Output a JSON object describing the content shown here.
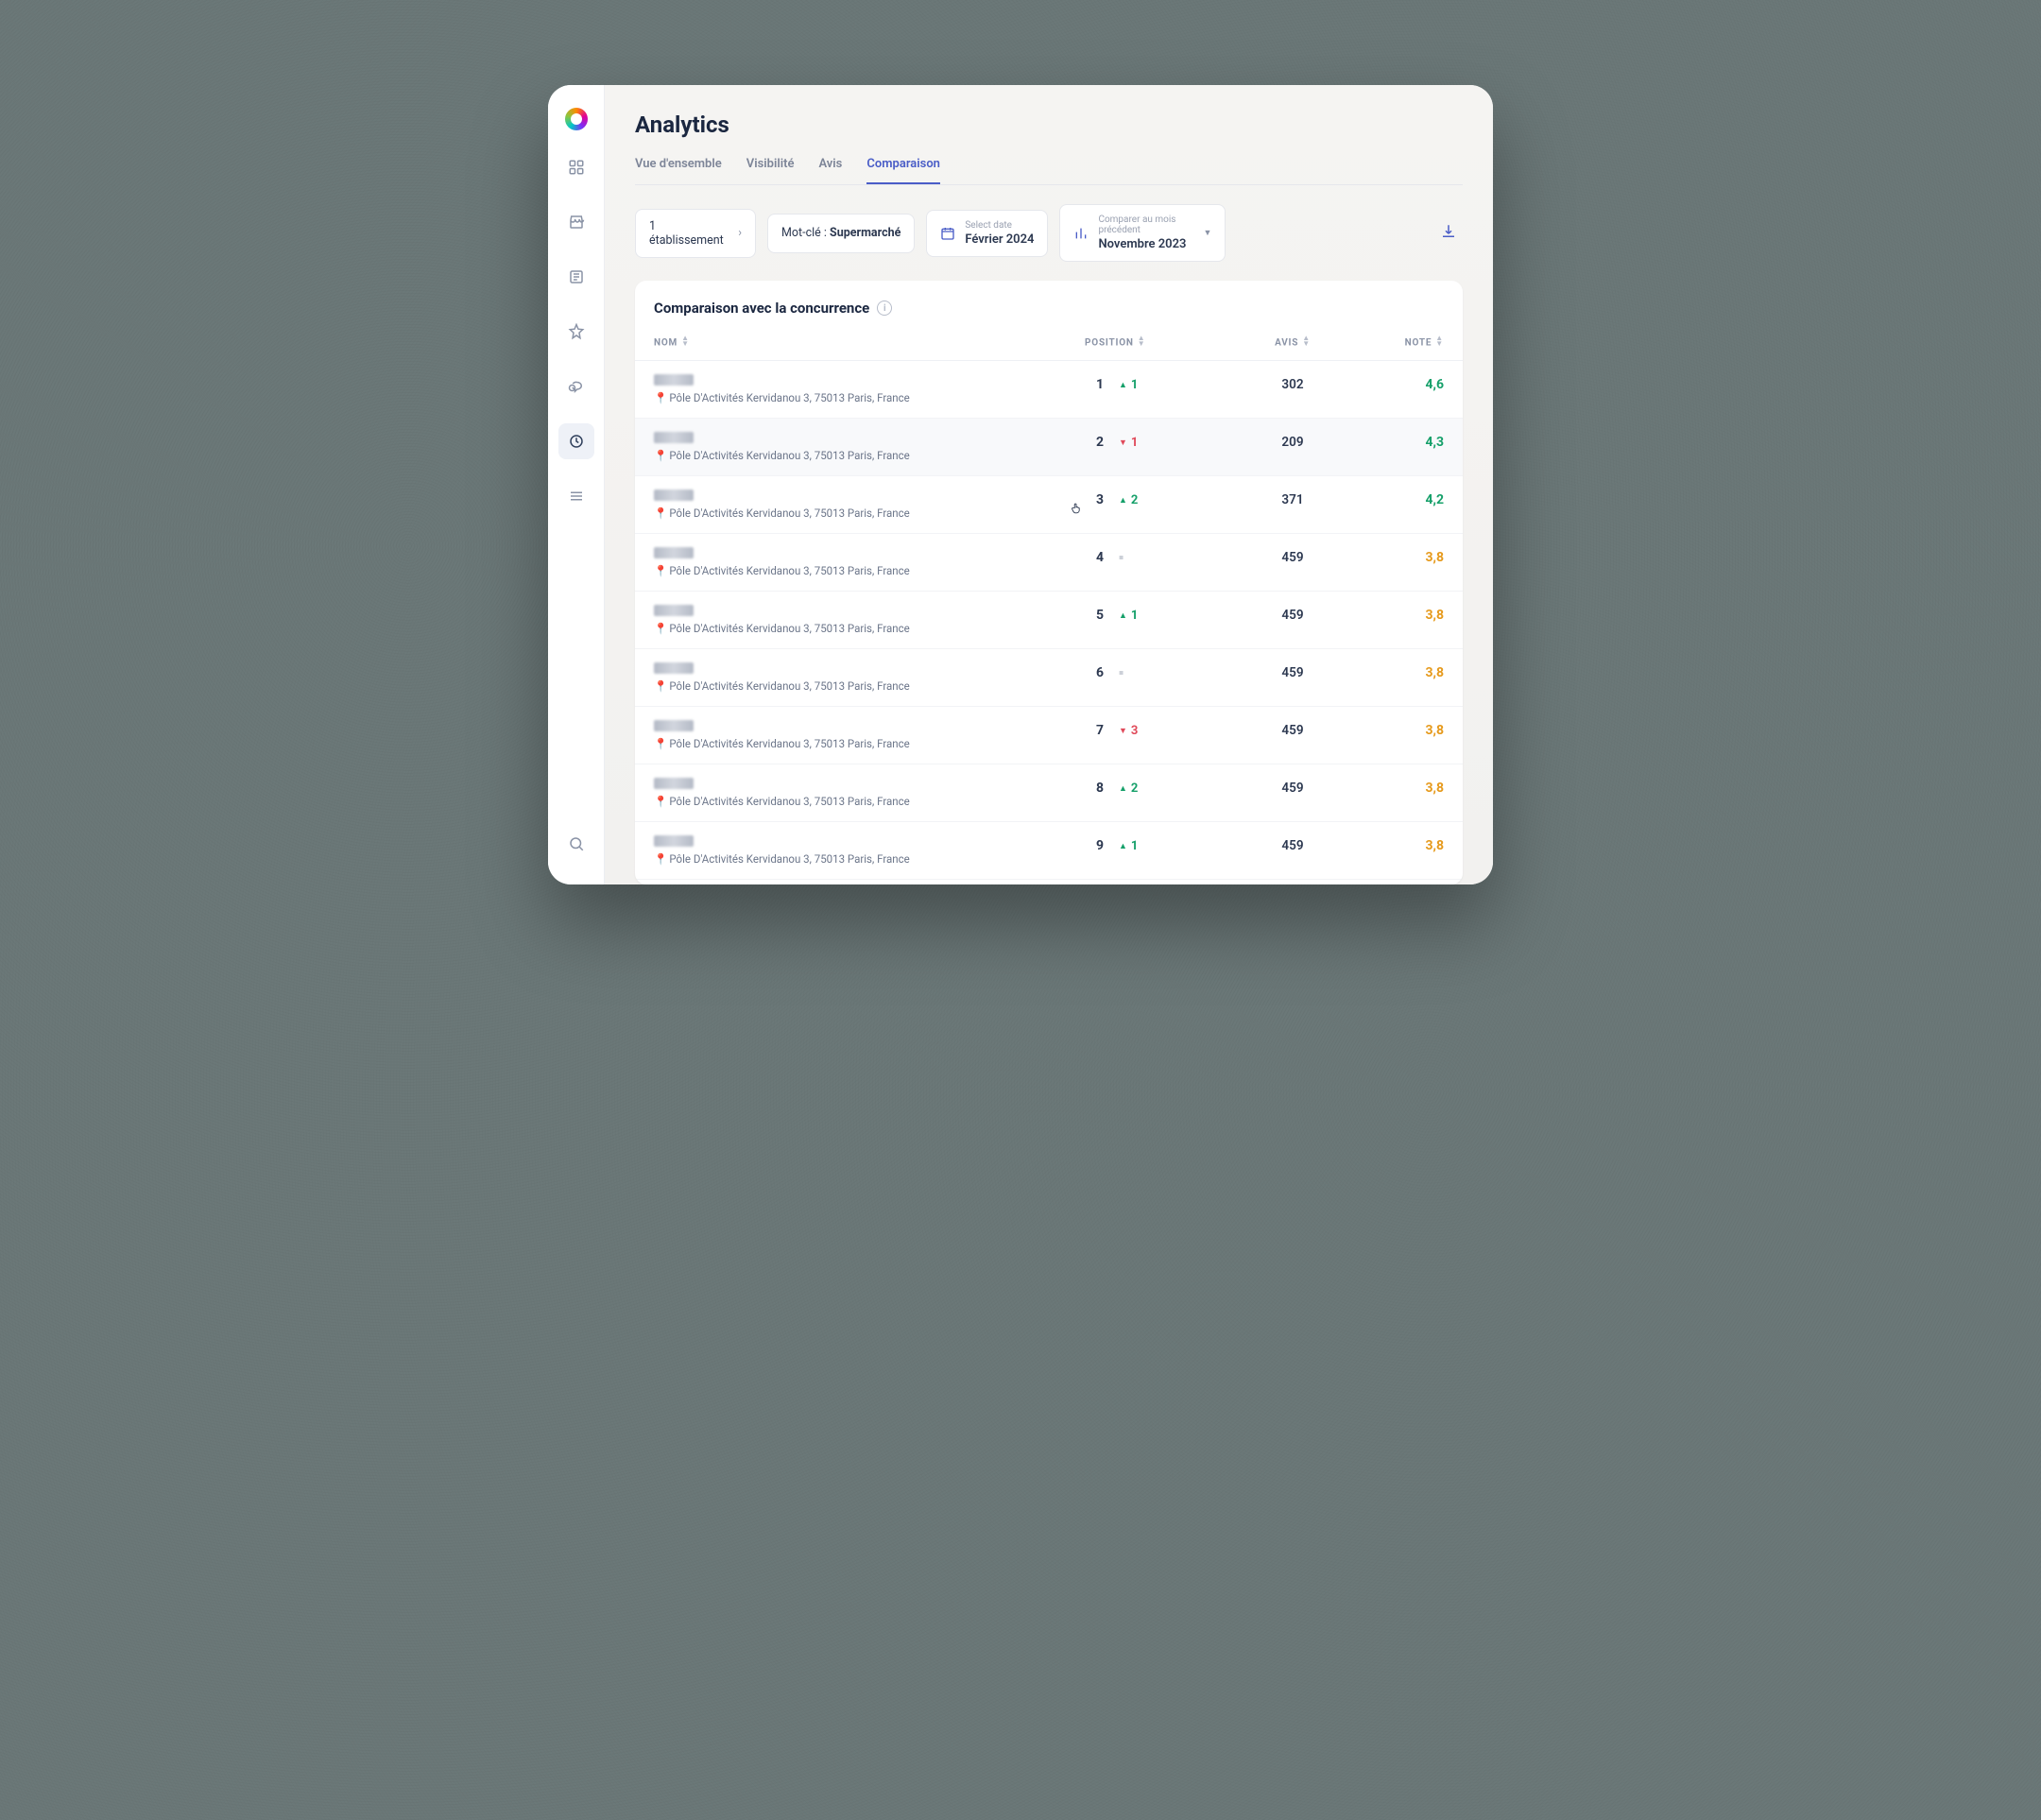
{
  "header": {
    "title": "Analytics"
  },
  "tabs": [
    {
      "label": "Vue d'ensemble",
      "active": false
    },
    {
      "label": "Visibilité",
      "active": false
    },
    {
      "label": "Avis",
      "active": false
    },
    {
      "label": "Comparaison",
      "active": true
    }
  ],
  "filters": {
    "establishment": "1 établissement",
    "keyword_prefix": "Mot-clé : ",
    "keyword_value": "Supermarché",
    "date_label": "Select date",
    "date_value": "Février 2024",
    "compare_label": "Comparer au mois précédent",
    "compare_value": "Novembre 2023"
  },
  "card": {
    "heading": "Comparaison avec la concurrence",
    "columns": {
      "name": "NOM",
      "position": "POSITION",
      "avis": "AVIS",
      "note": "NOTE"
    }
  },
  "address": "Pôle D'Activités Kervidanou 3, 75013 Paris, France",
  "rows": [
    {
      "pos": "1",
      "dir": "up",
      "delta": "1",
      "avis": "302",
      "note": "4,6",
      "note_cls": "g",
      "h": false
    },
    {
      "pos": "2",
      "dir": "down",
      "delta": "1",
      "avis": "209",
      "note": "4,3",
      "note_cls": "g",
      "h": true
    },
    {
      "pos": "3",
      "dir": "up",
      "delta": "2",
      "avis": "371",
      "note": "4,2",
      "note_cls": "g",
      "h": false
    },
    {
      "pos": "4",
      "dir": "eq",
      "delta": "",
      "avis": "459",
      "note": "3,8",
      "note_cls": "o",
      "h": false
    },
    {
      "pos": "5",
      "dir": "up",
      "delta": "1",
      "avis": "459",
      "note": "3,8",
      "note_cls": "o",
      "h": false
    },
    {
      "pos": "6",
      "dir": "eq",
      "delta": "",
      "avis": "459",
      "note": "3,8",
      "note_cls": "o",
      "h": false
    },
    {
      "pos": "7",
      "dir": "down",
      "delta": "3",
      "avis": "459",
      "note": "3,8",
      "note_cls": "o",
      "h": false
    },
    {
      "pos": "8",
      "dir": "up",
      "delta": "2",
      "avis": "459",
      "note": "3,8",
      "note_cls": "o",
      "h": false
    },
    {
      "pos": "9",
      "dir": "up",
      "delta": "1",
      "avis": "459",
      "note": "3,8",
      "note_cls": "o",
      "h": false
    }
  ]
}
